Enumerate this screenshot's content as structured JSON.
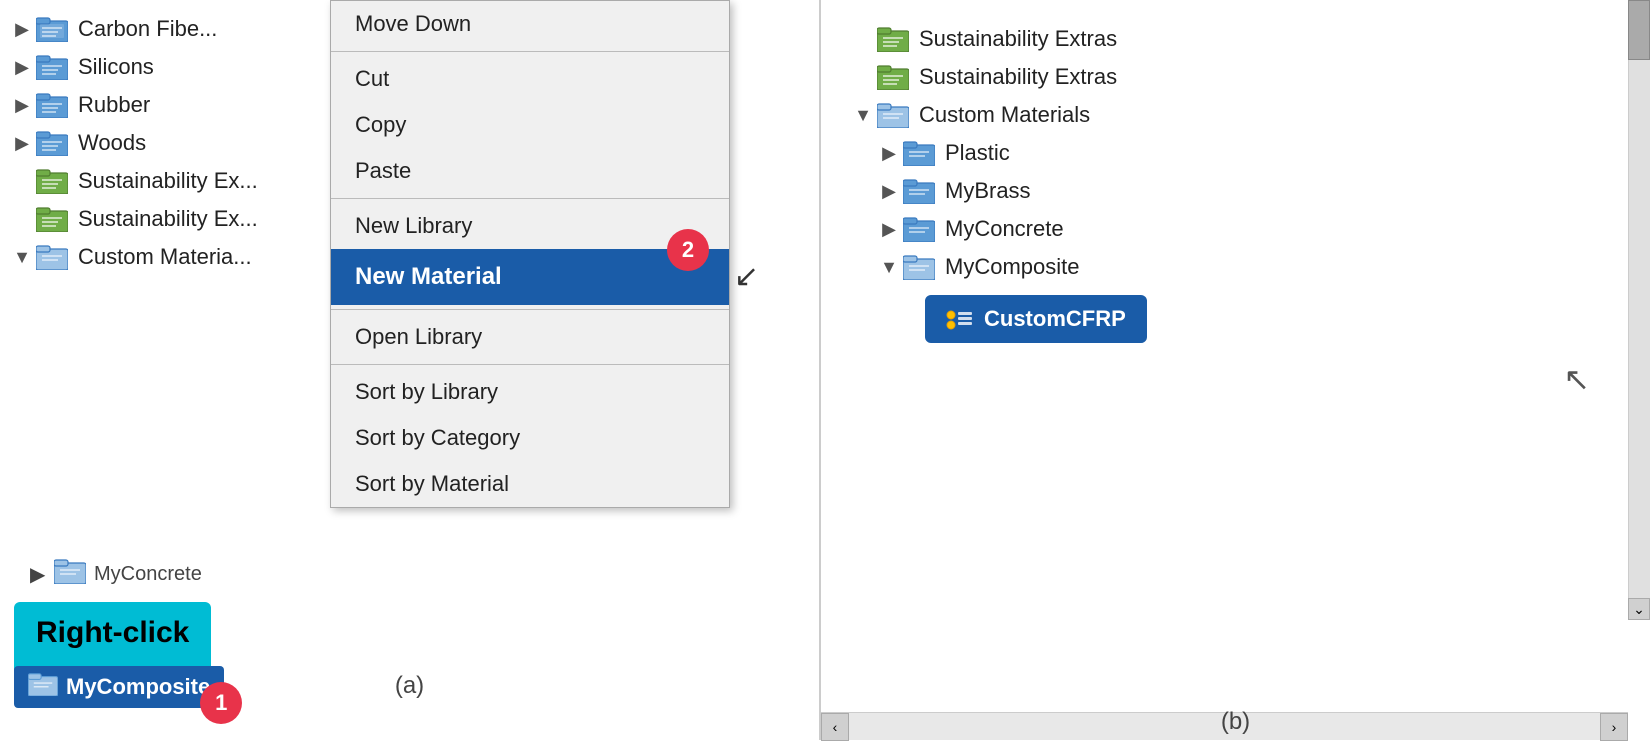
{
  "left": {
    "tree_items": [
      {
        "label": "Carbon Fibe...",
        "type": "folder-blue",
        "indent": 0,
        "chevron": "right"
      },
      {
        "label": "Silicons",
        "type": "folder-blue",
        "indent": 0,
        "chevron": "right"
      },
      {
        "label": "Rubber",
        "type": "folder-blue",
        "indent": 0,
        "chevron": "right"
      },
      {
        "label": "Woods",
        "type": "folder-blue",
        "indent": 0,
        "chevron": "right"
      },
      {
        "label": "Sustainability Ex...",
        "type": "folder-green",
        "indent": 0,
        "chevron": "none"
      },
      {
        "label": "Sustainability Ex...",
        "type": "folder-green",
        "indent": 0,
        "chevron": "none"
      },
      {
        "label": "Custom Materia...",
        "type": "folder-blue-open",
        "indent": 0,
        "chevron": "down"
      }
    ],
    "context_menu": {
      "items": [
        {
          "label": "Move Down",
          "separator_after": false
        },
        {
          "label": "",
          "separator": true
        },
        {
          "label": "Cut",
          "separator_after": false
        },
        {
          "label": "Copy",
          "separator_after": false
        },
        {
          "label": "Paste",
          "separator_after": false
        },
        {
          "label": "",
          "separator": true
        },
        {
          "label": "New Library",
          "separator_after": false
        },
        {
          "label": "New Material",
          "highlighted": true,
          "separator_after": false
        },
        {
          "label": "",
          "separator": true
        },
        {
          "label": "Open Library",
          "separator_after": false
        },
        {
          "label": "",
          "separator": true
        },
        {
          "label": "Sort by Library",
          "separator_after": false
        },
        {
          "label": "Sort by Category",
          "separator_after": false
        },
        {
          "label": "Sort by Material",
          "separator_after": false
        }
      ]
    },
    "callout": "Right-click",
    "mycomposite_label": "MyComposite",
    "myconcrete_label": "MyConcrete",
    "caption": "(a)",
    "badge1": "1",
    "badge2": "2"
  },
  "right": {
    "tree_items": [
      {
        "label": "Sustainability Extras",
        "type": "folder-green",
        "indent": 0
      },
      {
        "label": "Sustainability Extras",
        "type": "folder-green",
        "indent": 0
      },
      {
        "label": "Custom Materials",
        "type": "folder-blue-open",
        "indent": 0,
        "chevron": "down"
      },
      {
        "label": "Plastic",
        "type": "folder-blue",
        "indent": 1,
        "chevron": "right"
      },
      {
        "label": "MyBrass",
        "type": "folder-blue",
        "indent": 1,
        "chevron": "right"
      },
      {
        "label": "MyConcrete",
        "type": "folder-blue",
        "indent": 1,
        "chevron": "right"
      },
      {
        "label": "MyComposite",
        "type": "folder-blue-open",
        "indent": 1,
        "chevron": "down"
      },
      {
        "label": "CustomCFRP",
        "type": "material-blue",
        "indent": 2,
        "highlighted": true
      }
    ],
    "caption": "(b)"
  }
}
